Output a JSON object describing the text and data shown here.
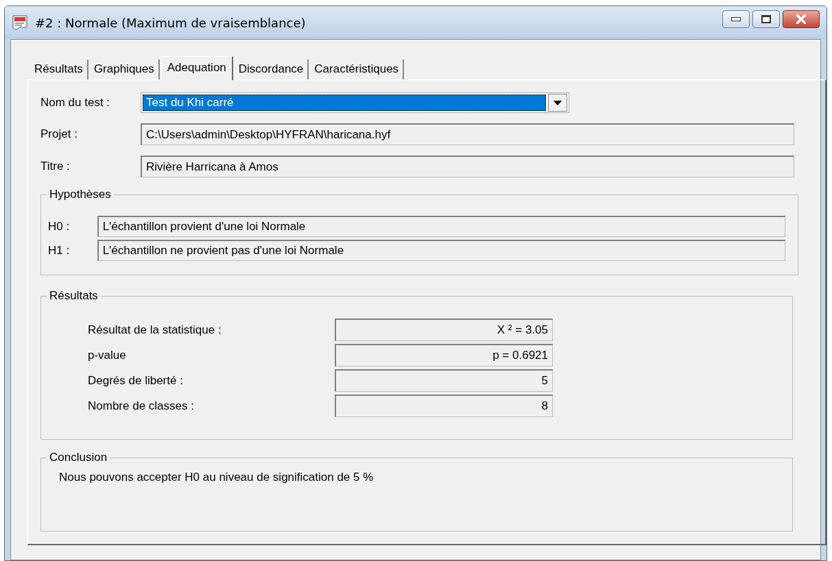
{
  "window": {
    "title": "#2 : Normale (Maximum de vraisemblance)"
  },
  "tabs": [
    {
      "label": "Résultats",
      "selected": false
    },
    {
      "label": "Graphiques",
      "selected": false
    },
    {
      "label": "Adequation",
      "selected": true
    },
    {
      "label": "Discordance",
      "selected": false
    },
    {
      "label": "Caractéristiques",
      "selected": false
    }
  ],
  "test": {
    "label": "Nom du test :",
    "value": "Test du Khi carré"
  },
  "fields": [
    {
      "label": "Projet :",
      "value": "C:\\Users\\admin\\Desktop\\HYFRAN\\haricana.hyf"
    },
    {
      "label": "Titre :",
      "value": "Rivière Harricana à Amos"
    }
  ],
  "hypotheses": {
    "title": "Hypothèses",
    "items": [
      {
        "label": "H0 :",
        "value": "L'échantillon provient d'une loi Normale"
      },
      {
        "label": "H1 :",
        "value": "L'échantillon ne provient pas d'une loi Normale"
      }
    ]
  },
  "results": {
    "title": "Résultats",
    "items": [
      {
        "label": "Résultat de la statistique :",
        "value": "X ² = 3.05"
      },
      {
        "label": "p-value",
        "value": "p = 0.6921"
      },
      {
        "label": "Degrés de liberté :",
        "value": "5"
      },
      {
        "label": "Nombre de classes :",
        "value": "8"
      }
    ]
  },
  "conclusion": {
    "title": "Conclusion",
    "text": "Nous pouvons accepter H0 au niveau de signification de 5 %"
  }
}
